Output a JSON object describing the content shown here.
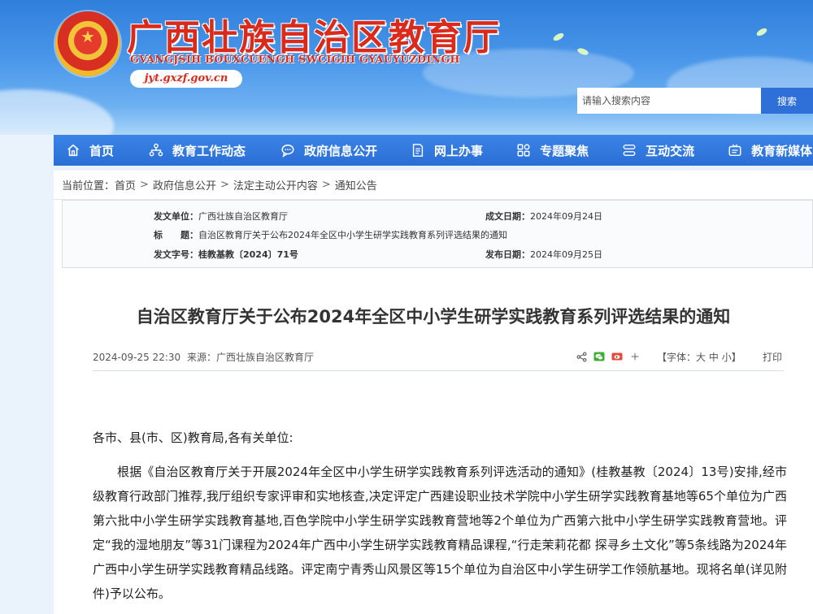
{
  "header": {
    "title": "广西壮族自治区教育厅",
    "pinyin": "GVANGJSIH BOUXCUENGH SWCIGIH GYAUYUZDINGH",
    "domain": "jyt.gxzf.gov.cn"
  },
  "search": {
    "placeholder": "请输入搜索内容",
    "button_label": "搜索"
  },
  "nav": {
    "items": [
      {
        "label": "首页",
        "icon": "home-icon"
      },
      {
        "label": "教育工作动态",
        "icon": "network-icon"
      },
      {
        "label": "政府信息公开",
        "icon": "chat-bubble-icon"
      },
      {
        "label": "网上办事",
        "icon": "document-edit-icon"
      },
      {
        "label": "专题聚焦",
        "icon": "grid-icon"
      },
      {
        "label": "互动交流",
        "icon": "exchange-icon"
      },
      {
        "label": "教育新媒体",
        "icon": "media-icon"
      }
    ]
  },
  "breadcrumb": {
    "prefix": "当前位置：",
    "items": [
      "首页",
      "政府信息公开",
      "法定主动公开内容",
      "通知公告"
    ],
    "separator": ">"
  },
  "meta": {
    "issuer_label": "发文单位：",
    "issuer": "广西壮族自治区教育厅",
    "date_label": "成文日期：",
    "date": "2024年09月24日",
    "title_label": "标　　题：",
    "title": "自治区教育厅关于公布2024年全区中小学生研学实践教育系列评选结果的通知",
    "doc_no_label": "发文字号：",
    "doc_no": "桂教基教〔2024〕71号",
    "publish_label": "发布日期：",
    "publish_date": "2024年09月25日"
  },
  "article": {
    "title": "自治区教育厅关于公布2024年全区中小学生研学实践教育系列评选结果的通知",
    "datetime": "2024-09-25 22:30",
    "source_label": "来源：",
    "source": "广西壮族自治区教育厅",
    "font_label_open": "【字体：",
    "font_large": "大",
    "font_medium": "中",
    "font_small": "小",
    "font_label_close": "】",
    "print_label": "打印",
    "salutation": "各市、县(市、区)教育局,各有关单位:",
    "paragraph": "根据《自治区教育厅关于开展2024年全区中小学生研学实践教育系列评选活动的通知》(桂教基教〔2024〕13号)安排,经市级教育行政部门推荐,我厅组织专家评审和实地核查,决定评定广西建设职业技术学院中小学生研学实践教育基地等65个单位为广西第六批中小学生研学实践教育基地,百色学院中小学生研学实践教育营地等2个单位为广西第六批中小学生研学实践教育营地。评定“我的湿地朋友”等31门课程为2024年广西中小学生研学实践教育精品课程,“行走茉莉花都 探寻乡土文化”等5条线路为2024年广西中小学生研学实践教育精品线路。评定南宁青秀山风景区等15个单位为自治区中小学生研学工作领航基地。现将名单(详见附件)予以公布。"
  },
  "colors": {
    "brand_red": "#d92a1c",
    "nav_blue": "#2a6ed6",
    "search_blue": "#2e6fd8"
  }
}
